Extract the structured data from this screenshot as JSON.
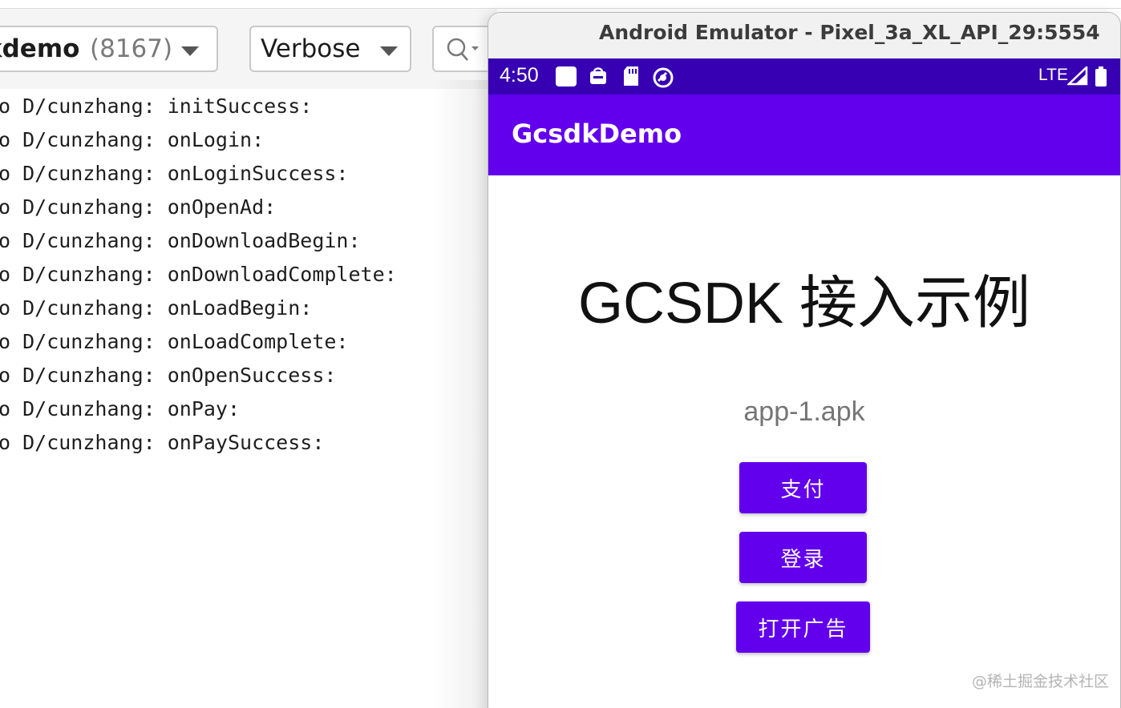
{
  "logcat": {
    "process_name": "kdemo",
    "process_pid": "(8167)",
    "log_level": "Verbose",
    "lines": [
      "o D/cunzhang: initSuccess:",
      "o D/cunzhang: onLogin:",
      "o D/cunzhang: onLoginSuccess:",
      "o D/cunzhang: onOpenAd:",
      "o D/cunzhang: onDownloadBegin:",
      "o D/cunzhang: onDownloadComplete:",
      "o D/cunzhang: onLoadBegin:",
      "o D/cunzhang: onLoadComplete:",
      "o D/cunzhang: onOpenSuccess:",
      "o D/cunzhang: onPay:",
      "o D/cunzhang: onPaySuccess:"
    ]
  },
  "emulator": {
    "window_title": "Android Emulator - Pixel_3a_XL_API_29:5554",
    "status_bar": {
      "time": "4:50",
      "network": "LTE",
      "icons": [
        "square-notification-icon",
        "store-icon",
        "sd-card-icon",
        "sync-icon",
        "signal-icon",
        "battery-icon"
      ]
    },
    "app": {
      "title": "GcsdkDemo",
      "headline": "GCSDK 接入示例",
      "apk_label": "app-1.apk",
      "buttons": {
        "pay": "支付",
        "login": "登录",
        "open_ad": "打开广告"
      }
    }
  },
  "watermark": "@稀土掘金技术社区",
  "colors": {
    "status_bar": "#3700b3",
    "app_bar": "#6200ee",
    "button": "#6200ee"
  }
}
